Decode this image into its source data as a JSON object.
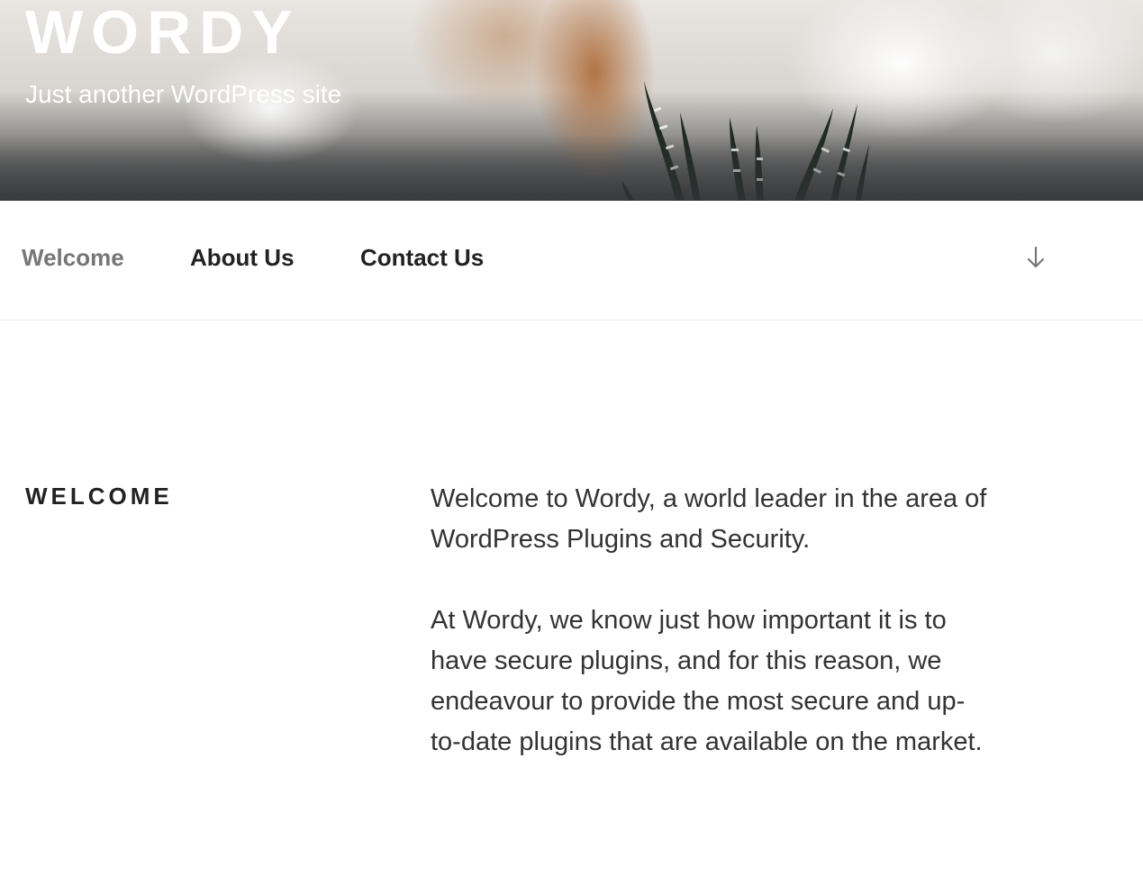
{
  "site": {
    "title": "WORDY",
    "tagline": "Just another WordPress site"
  },
  "nav": {
    "items": [
      {
        "label": "Welcome",
        "current": true
      },
      {
        "label": "About Us",
        "current": false
      },
      {
        "label": "Contact Us",
        "current": false
      }
    ],
    "scroll_icon": "arrow-down-icon"
  },
  "content": {
    "section_title": "WELCOME",
    "paragraphs": [
      "Welcome to Wordy, a world leader in the area of WordPress Plugins and Security.",
      "At Wordy, we know just how important it is to have secure plugins, and for this reason, we endeavour to provide the most secure and up-to-date plugins that are available on the market."
    ]
  },
  "colors": {
    "text_dark": "#222222",
    "text_body": "#333333",
    "nav_current": "#767676",
    "header_text": "#ffffff"
  }
}
